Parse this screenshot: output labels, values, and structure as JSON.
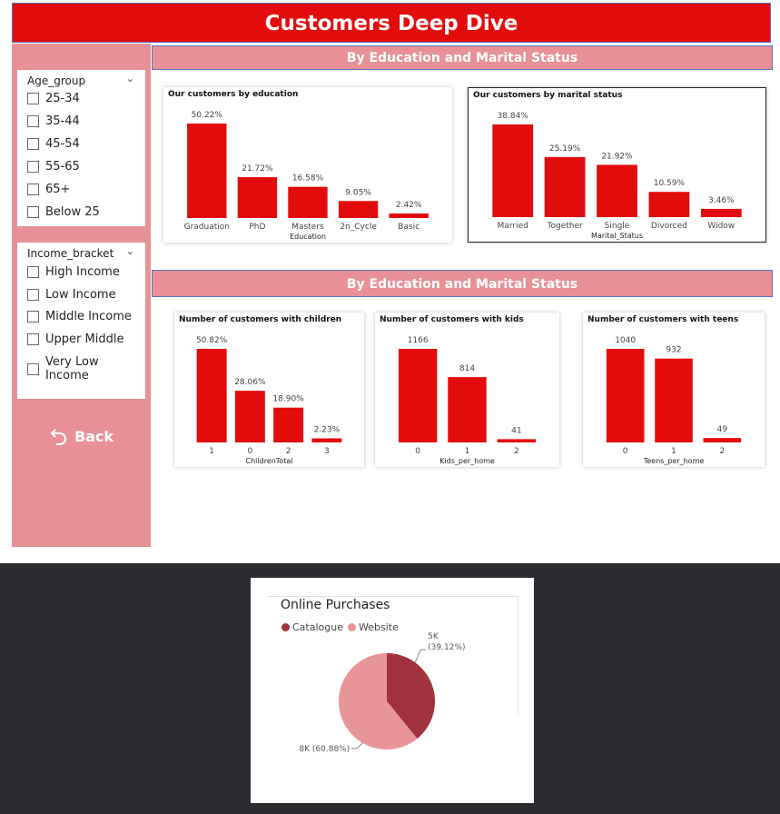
{
  "page_title": "Customers Deep Dive",
  "section1_title": "By Education and Marital Status",
  "section2_title": "By Education and Marital Status",
  "age_slicer": {
    "title": "Age_group",
    "options": [
      "25-34",
      "35-44",
      "45-54",
      "55-65",
      "65+",
      "Below 25"
    ]
  },
  "income_slicer": {
    "title": "Income_bracket",
    "options": [
      "High Income",
      "Low Income",
      "Middle Income",
      "Upper Middle",
      "Very Low Income"
    ]
  },
  "back_label": "Back",
  "colors": {
    "bar": "#e20c0c",
    "catalogue": "#a2323d",
    "website": "#e8959a"
  },
  "chart_data": [
    {
      "type": "bar",
      "title": "Our customers by education",
      "xlabel": "Education",
      "categories": [
        "Graduation",
        "PhD",
        "Masters",
        "2n_Cycle",
        "Basic"
      ],
      "values": [
        50.22,
        21.72,
        16.58,
        9.05,
        2.42
      ],
      "labels": [
        "50.22%",
        "21.72%",
        "16.58%",
        "9.05%",
        "2.42%"
      ]
    },
    {
      "type": "bar",
      "title": "Our customers by marital status",
      "xlabel": "Marital_Status",
      "categories": [
        "Married",
        "Together",
        "Single",
        "Divorced",
        "Widow"
      ],
      "values": [
        38.84,
        25.19,
        21.92,
        10.59,
        3.46
      ],
      "labels": [
        "38.84%",
        "25.19%",
        "21.92%",
        "10.59%",
        "3.46%"
      ]
    },
    {
      "type": "bar",
      "title": "Number of customers with children",
      "xlabel": "ChildrenTotal",
      "categories": [
        "1",
        "0",
        "2",
        "3"
      ],
      "values": [
        50.82,
        28.06,
        18.9,
        2.23
      ],
      "labels": [
        "50.82%",
        "28.06%",
        "18.90%",
        "2.23%"
      ]
    },
    {
      "type": "bar",
      "title": "Number of customers with kids",
      "xlabel": "Kids_per_home",
      "categories": [
        "0",
        "1",
        "2"
      ],
      "values": [
        1166,
        814,
        41
      ],
      "labels": [
        "1166",
        "814",
        "41"
      ]
    },
    {
      "type": "bar",
      "title": "Number of customers with teens",
      "xlabel": "Teens_per_home",
      "categories": [
        "0",
        "1",
        "2"
      ],
      "values": [
        1040,
        932,
        49
      ],
      "labels": [
        "1040",
        "932",
        "49"
      ]
    },
    {
      "type": "pie",
      "title": "Online Purchases",
      "legend": [
        "Catalogue",
        "Website"
      ],
      "values": [
        39.12,
        60.88
      ],
      "labels": [
        "5K",
        "8K (60.88%)"
      ],
      "sublabels": [
        "(39.12%)",
        ""
      ]
    }
  ]
}
